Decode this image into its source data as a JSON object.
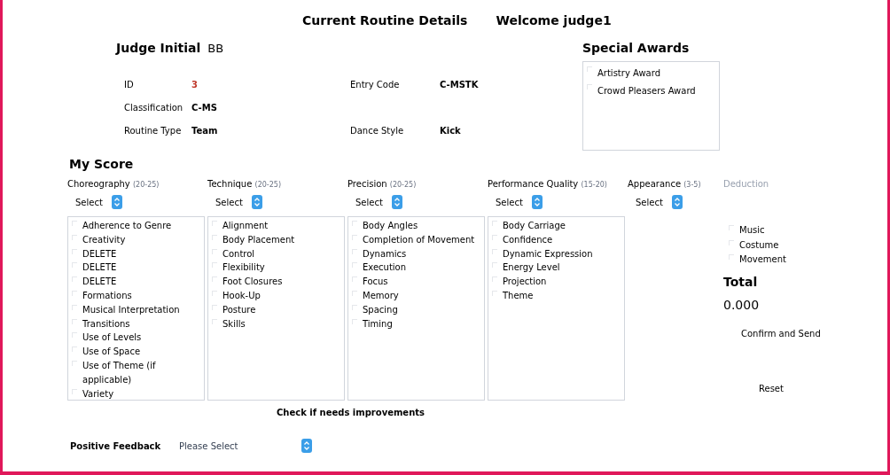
{
  "header": {
    "title": "Current Routine Details",
    "welcome": "Welcome judge1"
  },
  "judge": {
    "label": "Judge Initial",
    "value": "BB"
  },
  "info": [
    {
      "label": "ID",
      "value": "3",
      "highlight": true
    },
    {
      "label": "Entry Code",
      "value": "C-MSTK",
      "highlight": false
    },
    {
      "label": "Classification",
      "value": "C-MS",
      "highlight": false
    },
    {
      "label": "Routine Type",
      "value": "Team",
      "highlight": false
    },
    {
      "label": "Dance Style",
      "value": "Kick",
      "highlight": false
    }
  ],
  "special_awards": {
    "title": "Special Awards",
    "items": [
      {
        "label": "Artistry Award",
        "checked": false
      },
      {
        "label": "Crowd Pleasers Award",
        "checked": false
      }
    ]
  },
  "my_score": {
    "title": "My Score",
    "categories": [
      {
        "name": "Choreography",
        "range": "(20-25)",
        "select": "Select",
        "items": [
          {
            "label": "Adherence to Genre",
            "checked": false
          },
          {
            "label": "Creativity",
            "checked": false
          },
          {
            "label": "DELETE",
            "checked": false
          },
          {
            "label": "DELETE",
            "checked": false
          },
          {
            "label": "DELETE",
            "checked": false
          },
          {
            "label": "Formations",
            "checked": false
          },
          {
            "label": "Musical Interpretation",
            "checked": false
          },
          {
            "label": "Transitions",
            "checked": false
          },
          {
            "label": "Use of Levels",
            "checked": false
          },
          {
            "label": "Use of Space",
            "checked": false
          },
          {
            "label": "Use of Theme (if applicable)",
            "checked": false
          },
          {
            "label": "Variety",
            "checked": false
          }
        ]
      },
      {
        "name": "Technique",
        "range": "(20-25)",
        "select": "Select",
        "items": [
          {
            "label": "Alignment",
            "checked": false
          },
          {
            "label": "Body Placement",
            "checked": false
          },
          {
            "label": "Control",
            "checked": false
          },
          {
            "label": "Flexibility",
            "checked": false
          },
          {
            "label": "Foot Closures",
            "checked": false
          },
          {
            "label": "Hook-Up",
            "checked": false
          },
          {
            "label": "Posture",
            "checked": false
          },
          {
            "label": "Skills",
            "checked": false
          }
        ]
      },
      {
        "name": "Precision",
        "range": "(20-25)",
        "select": "Select",
        "items": [
          {
            "label": "Body Angles",
            "checked": false
          },
          {
            "label": "Completion of Movement",
            "checked": false
          },
          {
            "label": "Dynamics",
            "checked": false
          },
          {
            "label": "Execution",
            "checked": false
          },
          {
            "label": "Focus",
            "checked": false
          },
          {
            "label": "Memory",
            "checked": false
          },
          {
            "label": "Spacing",
            "checked": false
          },
          {
            "label": "Timing",
            "checked": false
          }
        ]
      },
      {
        "name": "Performance Quality",
        "range": "(15-20)",
        "select": "Select",
        "items": [
          {
            "label": "Body Carriage",
            "checked": false
          },
          {
            "label": "Confidence",
            "checked": false
          },
          {
            "label": "Dynamic Expression",
            "checked": false
          },
          {
            "label": "Energy Level",
            "checked": false
          },
          {
            "label": "Projection",
            "checked": false
          },
          {
            "label": "Theme",
            "checked": false
          }
        ]
      },
      {
        "name": "Appearance",
        "range": "(3-5)",
        "select": "Select"
      }
    ]
  },
  "deduction": {
    "title": "Deduction",
    "items": [
      {
        "label": "Music",
        "checked": false
      },
      {
        "label": "Costume",
        "checked": false
      },
      {
        "label": "Movement",
        "checked": false
      }
    ]
  },
  "total": {
    "label": "Total",
    "value": "0.000"
  },
  "buttons": [
    "Confirm and Send",
    "Reset"
  ],
  "improvements_note": "Check if needs improvements",
  "positive_feedback": {
    "label": "Positive Feedback",
    "placeholder": "Please Select"
  }
}
